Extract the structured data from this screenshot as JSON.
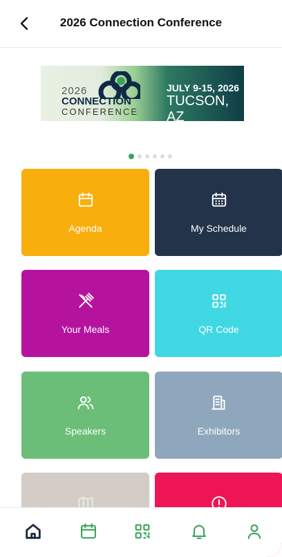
{
  "header": {
    "title": "2026 Connection Conference"
  },
  "banner": {
    "year": "2026",
    "name_line1": "CONNECTION",
    "name_line2": "CONFERENCE",
    "dates": "JULY 9-15, 2026",
    "location": "TUCSON, AZ"
  },
  "carousel": {
    "total": 6,
    "active_index": 0
  },
  "tiles": [
    {
      "label": "Agenda",
      "icon": "calendar-icon",
      "color": "#F8AE0C"
    },
    {
      "label": "My Schedule",
      "icon": "calendar-grid-icon",
      "color": "#22334A"
    },
    {
      "label": "Your Meals",
      "icon": "utensils-crossed-icon",
      "color": "#B5139E"
    },
    {
      "label": "QR Code",
      "icon": "qr-code-icon",
      "color": "#3FD8E3"
    },
    {
      "label": "Speakers",
      "icon": "people-icon",
      "color": "#6BBE78"
    },
    {
      "label": "Exhibitors",
      "icon": "building-icon",
      "color": "#8FA7BC"
    },
    {
      "label": "",
      "icon": "map-icon",
      "color": "#D3CCC7"
    },
    {
      "label": "",
      "icon": "alert-icon",
      "color": "#EE1556"
    }
  ],
  "bottom_nav": [
    {
      "icon": "home-icon",
      "active": true
    },
    {
      "icon": "calendar-icon",
      "active": false
    },
    {
      "icon": "qr-code-icon",
      "active": false
    },
    {
      "icon": "bell-icon",
      "active": false
    },
    {
      "icon": "profile-icon",
      "active": false
    }
  ],
  "colors": {
    "accent": "#3AA35A",
    "nav_active": "#1B2A3D"
  }
}
